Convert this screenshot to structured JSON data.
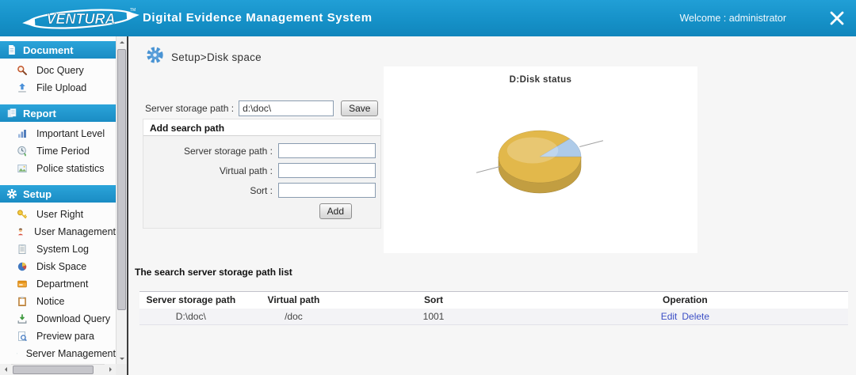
{
  "header": {
    "logo_text": "VENTURA",
    "logo_tm": "TM",
    "title": "Digital Evidence Management System",
    "welcome": "Welcome : administrator",
    "accent_color": "#1793c9"
  },
  "sidebar": {
    "sections": [
      {
        "label": "Document",
        "icon": "document-icon",
        "items": [
          {
            "label": "Doc Query",
            "icon": "doc-query-icon"
          },
          {
            "label": "File Upload",
            "icon": "file-upload-icon"
          }
        ]
      },
      {
        "label": "Report",
        "icon": "report-icon",
        "items": [
          {
            "label": "Important Level",
            "icon": "bar-chart-icon"
          },
          {
            "label": "Time Period",
            "icon": "clock-icon"
          },
          {
            "label": "Police statistics",
            "icon": "statistics-icon"
          }
        ]
      },
      {
        "label": "Setup",
        "icon": "gear-icon",
        "items": [
          {
            "label": "User Right",
            "icon": "key-icon"
          },
          {
            "label": "User Management",
            "icon": "user-icon"
          },
          {
            "label": "System Log",
            "icon": "log-icon"
          },
          {
            "label": "Disk Space",
            "icon": "pie-icon"
          },
          {
            "label": "Department",
            "icon": "department-icon"
          },
          {
            "label": "Notice",
            "icon": "notice-icon"
          },
          {
            "label": "Download Query",
            "icon": "download-icon"
          },
          {
            "label": "Preview para",
            "icon": "preview-icon"
          },
          {
            "label": "Server Management",
            "icon": "server-icon"
          }
        ]
      }
    ]
  },
  "main": {
    "breadcrumb": "Setup>Disk space",
    "storage_form": {
      "label": "Server storage path :",
      "value": "d:\\doc\\",
      "save_label": "Save"
    },
    "add_panel": {
      "title": "Add search path",
      "fields": [
        {
          "label": "Server storage path :",
          "value": ""
        },
        {
          "label": "Virtual path :",
          "value": ""
        },
        {
          "label": "Sort :",
          "value": ""
        }
      ],
      "add_label": "Add"
    },
    "list_title": "The search server storage path list",
    "table": {
      "columns": [
        "Server storage path",
        "Virtual path",
        "Sort",
        "Operation"
      ],
      "rows": [
        {
          "server_storage_path": "D:\\doc\\",
          "virtual_path": "/doc",
          "sort": "1001",
          "operations": [
            "Edit",
            "Delete"
          ]
        }
      ]
    }
  },
  "chart_data": {
    "type": "pie",
    "title": "D:Disk status",
    "style": "3d",
    "legend_position": "none",
    "segments": [
      {
        "label": "",
        "value": 88,
        "color": "#E2B84B"
      },
      {
        "label": "",
        "value": 12,
        "color": "#AECBE9"
      }
    ],
    "start_angle_deg": 43.2
  }
}
